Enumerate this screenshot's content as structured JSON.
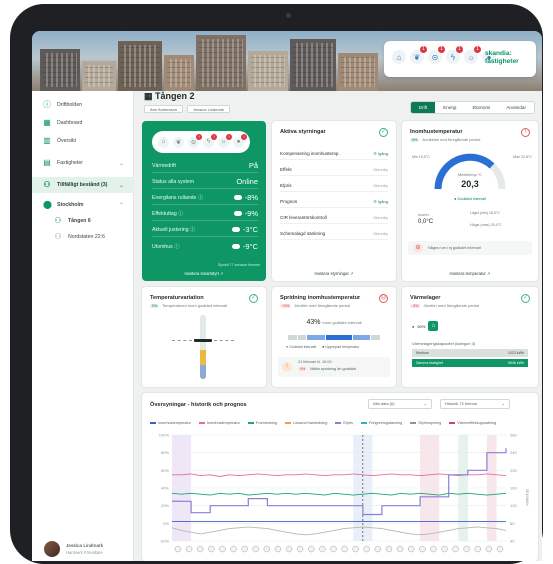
{
  "brand": {
    "name_line1": "skandia:",
    "name_line2": "fastigheter"
  },
  "header_icons": [
    {
      "icon": "house-icon",
      "badge": ""
    },
    {
      "icon": "leaf-icon",
      "badge": "1"
    },
    {
      "icon": "thermometer-icon",
      "badge": "1"
    },
    {
      "icon": "lightning-icon",
      "badge": "1"
    },
    {
      "icon": "sun-icon",
      "badge": "1"
    },
    {
      "icon": "drop-icon",
      "badge": ""
    }
  ],
  "sidebar": {
    "items": [
      {
        "label": "Driftbolden",
        "icon": "question-icon"
      },
      {
        "label": "Dashboard",
        "icon": "grid-icon"
      },
      {
        "label": "Översikt",
        "icon": "chart-icon"
      },
      {
        "label": "Fastigheter",
        "icon": "building-icon"
      },
      {
        "label": "Tillfälligt bestånd (3)",
        "icon": "people-icon"
      },
      {
        "label": "Stockholm",
        "icon": "pin-icon"
      },
      {
        "label": "Tången 6",
        "icon": "people-icon"
      },
      {
        "label": "Nordstaten 22:6",
        "icon": "people-icon"
      }
    ],
    "user": {
      "name": "Jessica Lindmark",
      "role": "Hantverk Förvaltare"
    }
  },
  "page": {
    "title": "Tången 2",
    "chips": [
      "Ann Andersson",
      "Jessica Lindmark"
    ],
    "tabs": [
      "Drift",
      "Energi",
      "Ekonomi",
      "Användar"
    ]
  },
  "status_card": {
    "icons": [
      "house-icon",
      "leaf-icon",
      "thermometer-icon",
      "lightning-icon",
      "sun-icon",
      "drop-icon"
    ],
    "rows": [
      {
        "label": "Värmedrift",
        "value": "På"
      },
      {
        "label": "Status alla system",
        "value": "Online"
      },
      {
        "label": "Energilans rullande ⓘ",
        "value": "-8%"
      },
      {
        "label": "Effektuttag ⓘ",
        "value": "-9%"
      },
      {
        "label": "Aktuell justering ⓘ",
        "value": "-3°C"
      },
      {
        "label": "Utomhus ⓘ",
        "value": "-9°C"
      }
    ],
    "note": "Sjunkit 77 senaste timmen",
    "link": "Hantera smartstyrt ↗"
  },
  "controls_card": {
    "title": "Aktiva styrningar",
    "rows": [
      {
        "label": "Kompensering inomhustemp.",
        "status": "Igång",
        "on": true
      },
      {
        "label": "Effekt",
        "status": "Standby",
        "on": false
      },
      {
        "label": "Elpris",
        "status": "Standby",
        "on": false
      },
      {
        "label": "Prognos",
        "status": "Igång",
        "on": true
      },
      {
        "label": "CIR leverantörskontroll",
        "status": "Standby",
        "on": false
      },
      {
        "label": "Schemalagd sänkning",
        "status": "Standby",
        "on": false
      }
    ],
    "link": "Hantera styrningar ↗"
  },
  "indoor_card": {
    "title": "Inomhustemperatur",
    "sub_pill": "5%",
    "sub_text": "Avvikelse mot föregående period",
    "gauge_min": "Min 19,5°C",
    "gauge_max": "Max 22,8°C",
    "mid_label": "Medeltemp °C",
    "mid_value": "20,3",
    "status": "Godkänt intervall",
    "left_label": "Inomh.",
    "left_value": "0,0°C",
    "right1": "Lägst (min) 18,5°C",
    "right2": "Högst (max) 25,4°C",
    "note": "Några rum i ej godkänt intervall",
    "link": "Hantera temperatur ↗"
  },
  "variation_card": {
    "title": "Temperaturvariation",
    "sub_pill": "0%",
    "sub_text": "Temperaturen inom godkänt intervall",
    "fill_fraction": 0.45
  },
  "spread_card": {
    "title": "Spridning inomhustemperatur",
    "sub_pill": "+3%",
    "sub_text": "Jämfört med föregående period",
    "percent": "43%",
    "percent_label": "Inom godkänt intervall",
    "legend1": "Godkänt intervall",
    "legend2": "Upprepad temperatur",
    "alert_title": "21 februari kl. 10:00",
    "alert_pill": "0%",
    "alert_text": "Mätta spridning än godkänt"
  },
  "heat_card": {
    "title": "Värmelager",
    "sub_pill": "-3%",
    "sub_text": "Jämfört med föregående period",
    "percent": "60%",
    "cap_label": "Värmelagringskapacitet (kategori 3)",
    "row1_label": "Medium",
    "row1_value": "1023 kWh",
    "row2_label": "Samma fastighet",
    "row2_value": "9546 kWh"
  },
  "chart_card": {
    "title": "Översyningar - historik och prognos",
    "select1": "Alla data (6)",
    "select2": "Historik 72 timmar",
    "legend": [
      {
        "name": "Inomhustemperatur",
        "color": "#3a5fcc"
      },
      {
        "name": "Inomhustemperatur",
        "color": "#e86aa2"
      },
      {
        "name": "Framledning",
        "color": "#1aa57a"
      },
      {
        "name": "Lokamd framledning",
        "color": "#f0a33b"
      },
      {
        "name": "Elpris",
        "color": "#8b7fd6"
      },
      {
        "name": "Fringreningstaxning",
        "color": "#2eb4c8"
      },
      {
        "name": "Styrinstyrning",
        "color": "#8a9a94"
      },
      {
        "name": "Värmeeffektuppsatning",
        "color": "#d23a8c"
      }
    ],
    "y_left": [
      "100%",
      "80%",
      "60%",
      "40%",
      "20%",
      "0%",
      "-20%"
    ],
    "y_right": [
      "280",
      "240",
      "200",
      "160",
      "120",
      "80",
      "40"
    ],
    "y_right_label": "SEK/MWh"
  },
  "chart_data": {
    "type": "line",
    "x_count": 36,
    "ylim": [
      -20,
      100
    ],
    "series": [
      {
        "values": [
          55,
          55,
          56,
          54,
          55,
          53,
          55,
          54,
          55,
          56,
          55,
          54,
          55,
          55,
          56,
          55,
          54,
          55,
          55,
          56,
          55,
          54,
          55,
          56,
          55,
          55,
          54,
          55,
          56,
          55,
          54,
          55,
          55,
          56,
          55,
          54
        ]
      },
      {
        "values": [
          34,
          33,
          34,
          33,
          32,
          34,
          33,
          34,
          32,
          33,
          34,
          33,
          34,
          33,
          34,
          33,
          32,
          34,
          33,
          32,
          33,
          34,
          33,
          32,
          34,
          33,
          34,
          33,
          32,
          34,
          33,
          34,
          33,
          32,
          33,
          34
        ]
      },
      {
        "values": [
          25,
          25,
          12,
          12,
          20,
          20,
          20,
          20,
          28,
          28,
          20,
          20,
          20,
          20,
          20,
          20,
          20,
          20,
          20,
          20,
          10,
          10,
          20,
          20,
          20,
          20,
          30,
          30,
          30,
          55,
          55,
          60,
          60,
          80,
          80,
          85
        ]
      },
      {
        "values": [
          2,
          2,
          2,
          2,
          2,
          2,
          2,
          2,
          2,
          2,
          2,
          2,
          2,
          2,
          2,
          2,
          2,
          2,
          2,
          2,
          2,
          2,
          2,
          2,
          2,
          2,
          2,
          2,
          2,
          2,
          2,
          2,
          2,
          2,
          2,
          2
        ]
      },
      {
        "values": [
          -5,
          -8,
          -10,
          -12,
          -10,
          -8,
          -6,
          -5,
          -4,
          -5,
          -6,
          -8,
          -10,
          -12,
          -13,
          -12,
          -10,
          -8,
          -6,
          -5,
          -4,
          -5,
          -6,
          -8,
          -10,
          -12,
          -13,
          -12,
          -10,
          -8,
          -6,
          -5,
          -4,
          -5,
          -6,
          -8
        ]
      }
    ]
  }
}
